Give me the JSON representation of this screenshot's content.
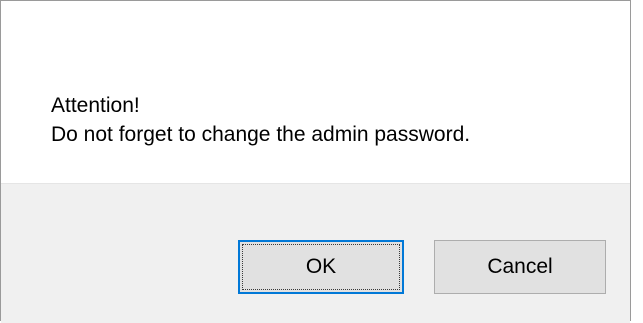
{
  "dialog": {
    "message_line1": "Attention!",
    "message_line2": "Do not forget to change the admin password.",
    "ok_label": "OK",
    "cancel_label": "Cancel"
  },
  "colors": {
    "content_bg": "#ffffff",
    "footer_bg": "#f0f0f0",
    "button_bg": "#e1e1e1",
    "default_button_border": "#0078d7",
    "button_border": "#adadad"
  }
}
